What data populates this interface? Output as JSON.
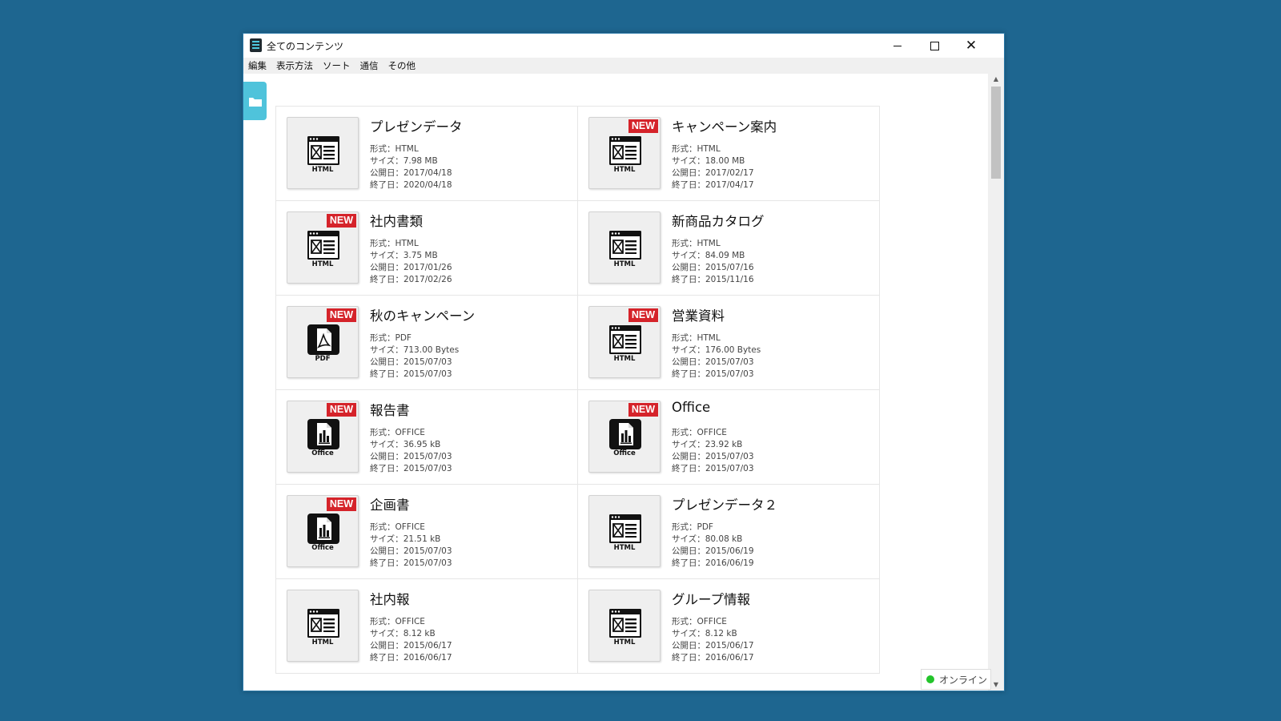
{
  "window": {
    "title": "全てのコンテンツ"
  },
  "menu": [
    "編集",
    "表示方法",
    "ソート",
    "通信",
    "その他"
  ],
  "status": {
    "text": "オンライン",
    "color": "#23c42b"
  },
  "labels": {
    "format": "形式：",
    "size": "サイズ：",
    "published": "公開日：",
    "ended": "終了日：",
    "new_badge": "NEW"
  },
  "items": [
    {
      "title": "プレゼンデータ",
      "icon": "html-page-icon",
      "type_label": "HTML",
      "is_new": false,
      "format": "HTML",
      "size": "7.98 MB",
      "published": "2017/04/18",
      "ended": "2020/04/18"
    },
    {
      "title": "キャンペーン案内",
      "icon": "html-page-icon",
      "type_label": "HTML",
      "is_new": true,
      "format": "HTML",
      "size": "18.00 MB",
      "published": "2017/02/17",
      "ended": "2017/04/17"
    },
    {
      "title": "社内書類",
      "icon": "html-page-icon",
      "type_label": "HTML",
      "is_new": true,
      "format": "HTML",
      "size": "3.75 MB",
      "published": "2017/01/26",
      "ended": "2017/02/26"
    },
    {
      "title": "新商品カタログ",
      "icon": "html-page-icon",
      "type_label": "HTML",
      "is_new": false,
      "format": "HTML",
      "size": "84.09 MB",
      "published": "2015/07/16",
      "ended": "2015/11/16"
    },
    {
      "title": "秋のキャンペーン",
      "icon": "pdf-file-icon",
      "type_label": "PDF",
      "is_new": true,
      "format": "PDF",
      "size": "713.00 Bytes",
      "published": "2015/07/03",
      "ended": "2015/07/03"
    },
    {
      "title": "営業資料",
      "icon": "html-page-icon",
      "type_label": "HTML",
      "is_new": true,
      "format": "HTML",
      "size": "176.00 Bytes",
      "published": "2015/07/03",
      "ended": "2015/07/03"
    },
    {
      "title": "報告書",
      "icon": "office-file-icon",
      "type_label": "Office",
      "is_new": true,
      "format": "OFFICE",
      "size": "36.95 kB",
      "published": "2015/07/03",
      "ended": "2015/07/03"
    },
    {
      "title": "Office",
      "icon": "office-file-icon",
      "type_label": "Office",
      "is_new": true,
      "format": "OFFICE",
      "size": "23.92 kB",
      "published": "2015/07/03",
      "ended": "2015/07/03"
    },
    {
      "title": "企画書",
      "icon": "office-file-icon",
      "type_label": "Office",
      "is_new": true,
      "format": "OFFICE",
      "size": "21.51 kB",
      "published": "2015/07/03",
      "ended": "2015/07/03"
    },
    {
      "title": "プレゼンデータ２",
      "icon": "html-page-icon",
      "type_label": "HTML",
      "is_new": false,
      "format": "PDF",
      "size": "80.08 kB",
      "published": "2015/06/19",
      "ended": "2016/06/19"
    },
    {
      "title": "社内報",
      "icon": "html-page-icon",
      "type_label": "HTML",
      "is_new": false,
      "format": "OFFICE",
      "size": "8.12 kB",
      "published": "2015/06/17",
      "ended": "2016/06/17"
    },
    {
      "title": "グループ情報",
      "icon": "html-page-icon",
      "type_label": "HTML",
      "is_new": false,
      "format": "OFFICE",
      "size": "8.12 kB",
      "published": "2015/06/17",
      "ended": "2016/06/17"
    }
  ]
}
